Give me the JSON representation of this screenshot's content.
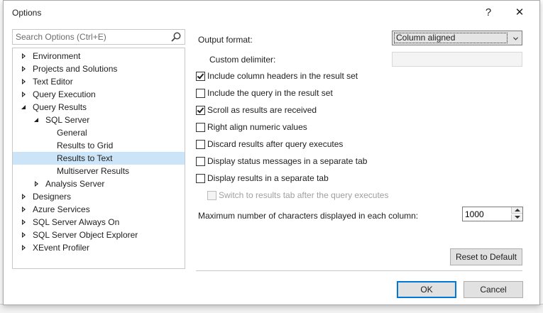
{
  "dialog": {
    "title": "Options",
    "help_glyph": "?",
    "close_glyph": "✕"
  },
  "search": {
    "placeholder": "Search Options (Ctrl+E)"
  },
  "tree": [
    {
      "label": "Environment",
      "state": "collapsed",
      "level": 0
    },
    {
      "label": "Projects and Solutions",
      "state": "collapsed",
      "level": 0
    },
    {
      "label": "Text Editor",
      "state": "collapsed",
      "level": 0
    },
    {
      "label": "Query Execution",
      "state": "collapsed",
      "level": 0
    },
    {
      "label": "Query Results",
      "state": "expanded",
      "level": 0
    },
    {
      "label": "SQL Server",
      "state": "expanded",
      "level": 1
    },
    {
      "label": "General",
      "state": "leaf",
      "level": 2
    },
    {
      "label": "Results to Grid",
      "state": "leaf",
      "level": 2
    },
    {
      "label": "Results to Text",
      "state": "leaf",
      "level": 2,
      "selected": true
    },
    {
      "label": "Multiserver Results",
      "state": "leaf",
      "level": 2
    },
    {
      "label": "Analysis Server",
      "state": "collapsed",
      "level": 1
    },
    {
      "label": "Designers",
      "state": "collapsed",
      "level": 0
    },
    {
      "label": "Azure Services",
      "state": "collapsed",
      "level": 0
    },
    {
      "label": "SQL Server Always On",
      "state": "collapsed",
      "level": 0
    },
    {
      "label": "SQL Server Object Explorer",
      "state": "collapsed",
      "level": 0
    },
    {
      "label": "XEvent Profiler",
      "state": "collapsed",
      "level": 0
    }
  ],
  "options": {
    "output_format_label": "Output format:",
    "output_format_value": "Column aligned",
    "custom_delimiter_label": "Custom delimiter:",
    "custom_delimiter_value": "",
    "checkboxes": [
      {
        "label": "Include column headers in the result set",
        "checked": true,
        "disabled": false
      },
      {
        "label": "Include the query in the result set",
        "checked": false,
        "disabled": false
      },
      {
        "label": "Scroll as results are received",
        "checked": true,
        "disabled": false
      },
      {
        "label": "Right align numeric values",
        "checked": false,
        "disabled": false
      },
      {
        "label": "Discard results after query executes",
        "checked": false,
        "disabled": false
      },
      {
        "label": "Display status messages in a separate tab",
        "checked": false,
        "disabled": false
      },
      {
        "label": "Display results in a separate tab",
        "checked": false,
        "disabled": false
      },
      {
        "label": "Switch to results tab after the query executes",
        "checked": false,
        "disabled": true
      }
    ],
    "max_chars_label": "Maximum number of characters displayed in each column:",
    "max_chars_value": "1000"
  },
  "buttons": {
    "reset": "Reset to Default",
    "ok": "OK",
    "cancel": "Cancel"
  },
  "colors": {
    "selection": "#cce4f7",
    "default_button_border": "#0078d7",
    "background_code_green": "#2e7d32"
  }
}
